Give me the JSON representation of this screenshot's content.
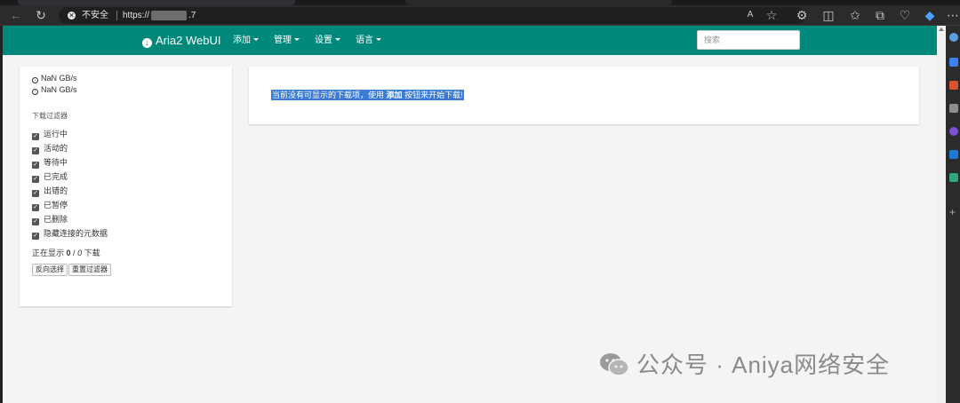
{
  "browser": {
    "security_label": "不安全",
    "url_prefix": "https://",
    "url_suffix": ".7"
  },
  "navbar": {
    "brand": "Aria2 WebUI",
    "menus": [
      "添加",
      "管理",
      "设置",
      "语言"
    ],
    "search_placeholder": "搜索"
  },
  "sidebar": {
    "download_speed": "NaN GB/s",
    "upload_speed": "NaN GB/s",
    "filter_title": "下载过滤器",
    "filters": [
      "运行中",
      "活动的",
      "等待中",
      "已完成",
      "出错的",
      "已暂停",
      "已删除",
      "隐藏连接的元数据"
    ],
    "showing_prefix": "正在显示",
    "shown_count": "0",
    "total_count": "0",
    "showing_suffix": "下载",
    "invert_button": "反向选择",
    "reset_button": "重置过滤器"
  },
  "main": {
    "empty_prefix": "当前没有可显示的下载项，使用",
    "empty_link": "添加",
    "empty_suffix": "按钮来开始下载!"
  },
  "watermark": {
    "text": "公众号 · Aniya网络安全"
  },
  "colors": {
    "navbar": "#00897b",
    "selection": "#3a7bd5"
  }
}
